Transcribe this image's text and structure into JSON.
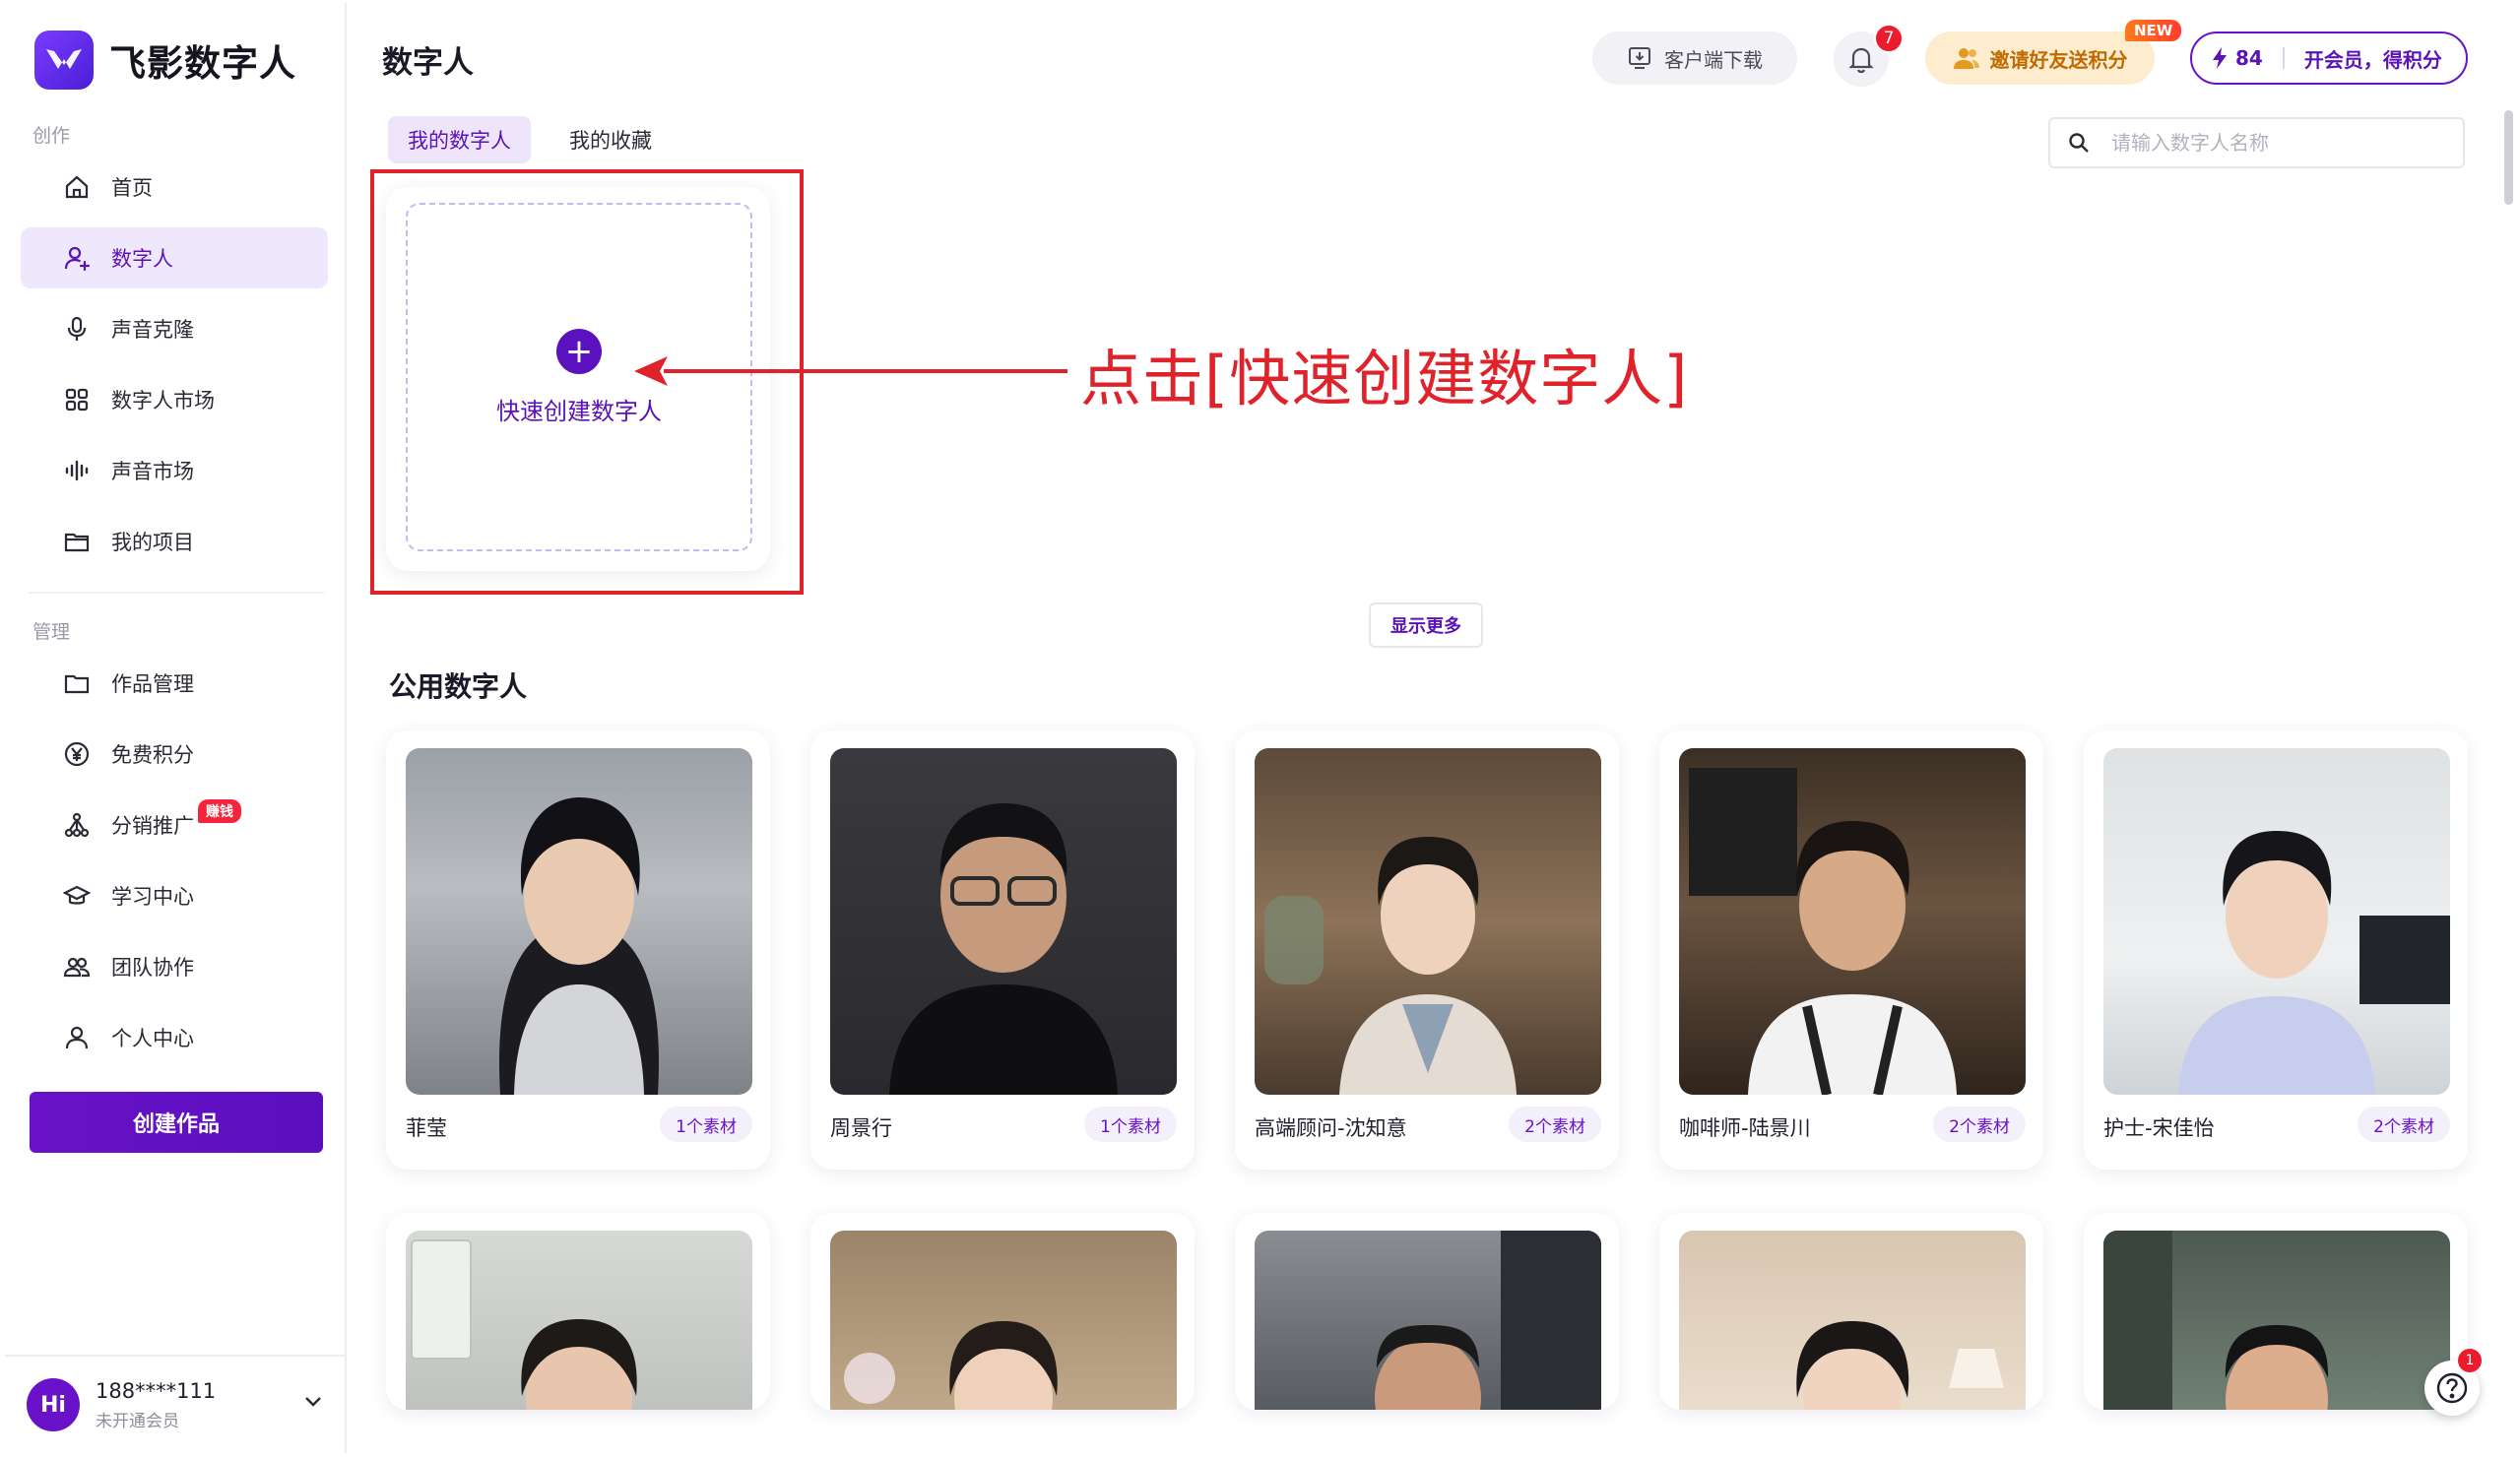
{
  "app": {
    "brand": "飞影数字人"
  },
  "sidebar": {
    "group_create": "创作",
    "group_manage": "管理",
    "create_items": [
      {
        "label": "首页",
        "icon": "home-icon"
      },
      {
        "label": "数字人",
        "icon": "digital-human-icon",
        "active": true
      },
      {
        "label": "声音克隆",
        "icon": "microphone-icon"
      },
      {
        "label": "数字人市场",
        "icon": "grid-icon"
      },
      {
        "label": "声音市场",
        "icon": "soundwave-icon"
      },
      {
        "label": "我的项目",
        "icon": "project-folder-icon"
      }
    ],
    "manage_items": [
      {
        "label": "作品管理",
        "icon": "folder-icon"
      },
      {
        "label": "免费积分",
        "icon": "yen-coin-icon"
      },
      {
        "label": "分销推广",
        "icon": "share-network-icon",
        "badge": "赚钱"
      },
      {
        "label": "学习中心",
        "icon": "graduation-cap-icon"
      },
      {
        "label": "团队协作",
        "icon": "team-icon"
      },
      {
        "label": "个人中心",
        "icon": "user-icon"
      }
    ],
    "create_button": "创建作品",
    "user": {
      "avatar": "Hi",
      "phone": "188****111",
      "tier": "未开通会员"
    }
  },
  "header": {
    "title": "数字人",
    "download": "客户端下载",
    "notifications": "7",
    "invite": "邀请好友送积分",
    "invite_tag": "NEW",
    "points": "84",
    "vip": "开会员，得积分"
  },
  "tabs": [
    {
      "label": "我的数字人",
      "active": true
    },
    {
      "label": "我的收藏",
      "active": false
    }
  ],
  "search": {
    "placeholder": "请输入数字人名称",
    "value": ""
  },
  "create_card": {
    "label": "快速创建数字人"
  },
  "annotation": "点击[快速创建数字人]",
  "show_more": "显示更多",
  "public_section": {
    "title": "公用数字人",
    "personas": [
      {
        "name": "菲莹",
        "count": "1个素材"
      },
      {
        "name": "周景行",
        "count": "1个素材"
      },
      {
        "name": "高端顾问-沈知意",
        "count": "2个素材"
      },
      {
        "name": "咖啡师-陆景川",
        "count": "2个素材"
      },
      {
        "name": "护士-宋佳怡",
        "count": "2个素材"
      }
    ]
  },
  "help": {
    "badge": "1"
  },
  "colors": {
    "accent": "#5b12b8",
    "annotation_red": "#e0222b",
    "badge_red": "#ec1c2e"
  }
}
